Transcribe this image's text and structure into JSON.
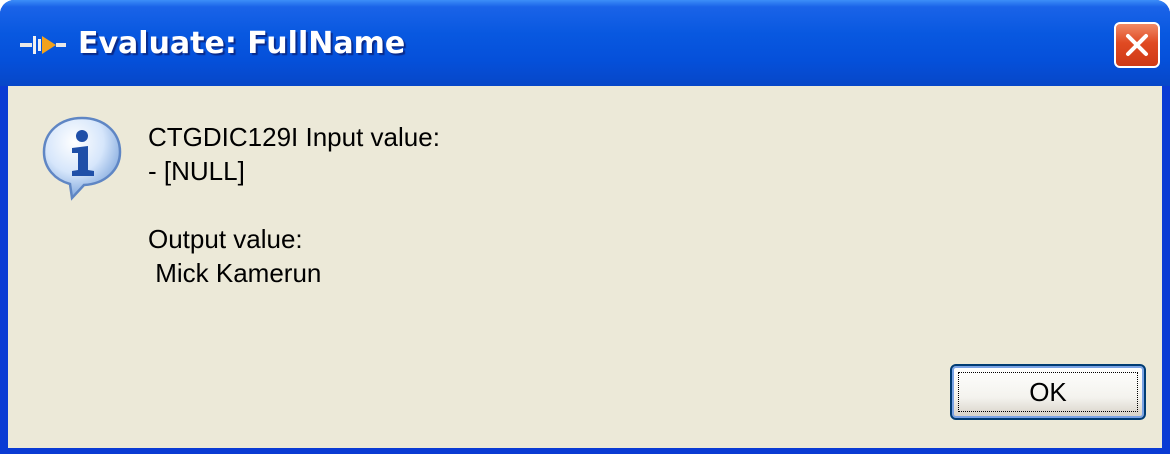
{
  "window": {
    "title": "Evaluate: FullName",
    "title_icon": "evaluate-icon",
    "close_icon": "close-icon"
  },
  "message": {
    "icon": "info-icon",
    "text": "CTGDIC129I Input value:\n- [NULL]\n\nOutput value:\n Mick Kamerun"
  },
  "buttons": {
    "ok_label": "OK"
  },
  "colors": {
    "titlebar": "#0858e0",
    "client_background": "#ece9d8",
    "close_button": "#e04a22"
  }
}
